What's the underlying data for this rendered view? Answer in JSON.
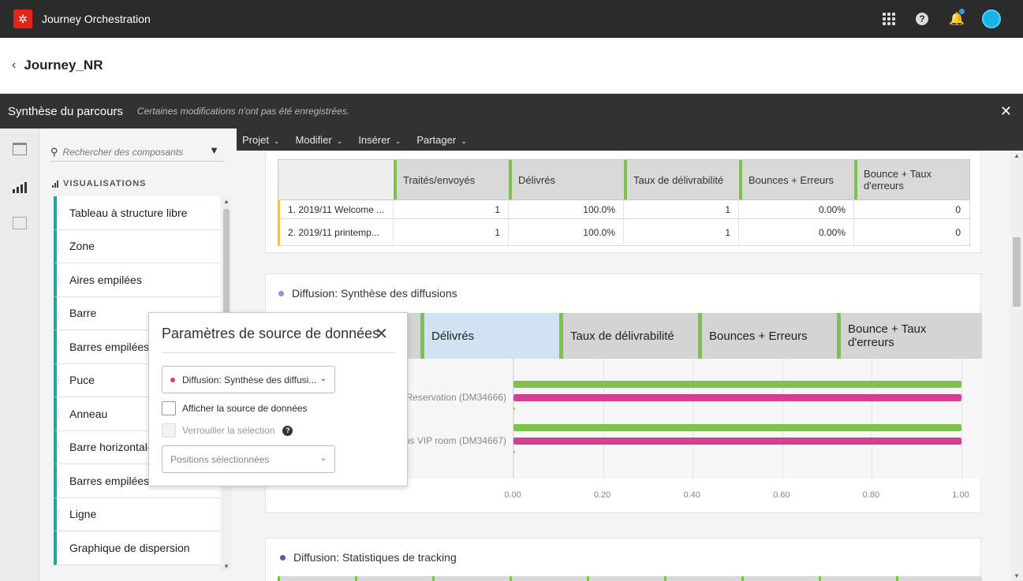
{
  "app": {
    "title": "Journey Orchestration"
  },
  "journey": {
    "name": "Journey_NR"
  },
  "summary_bar": {
    "title": "Synthèse du parcours",
    "note": "Certaines modifications n'ont pas été enregistrées."
  },
  "menu": [
    {
      "label": "Projet"
    },
    {
      "label": "Modifier"
    },
    {
      "label": "Insérer"
    },
    {
      "label": "Partager"
    }
  ],
  "components": {
    "search_placeholder": "Rechercher des composants",
    "section_title": "VISUALISATIONS",
    "items": [
      "Tableau à structure libre",
      "Zone",
      "Aires empilées",
      "Barre",
      "Barres empilées",
      "Puce",
      "Anneau",
      "Barre horizontale",
      "Barres empilées",
      "Ligne",
      "Graphique de dispersion"
    ]
  },
  "table1": {
    "columns": [
      "Traités/envoyés",
      "Délivrés",
      "Taux de délivrabilité",
      "Bounces + Erreurs",
      "Bounce + Taux d'erreurs"
    ],
    "rows": [
      {
        "name": "1.   2019/11 Welcome ...",
        "values": [
          "1",
          "100.0%",
          "1",
          "0.00%",
          "0"
        ]
      },
      {
        "name": "2.   2019/11 printemp...",
        "values": [
          "1",
          "100.0%",
          "1",
          "0.00%",
          "0"
        ]
      }
    ]
  },
  "card2": {
    "title": "Diffusion: Synthèse des diffusions",
    "dot_color": "#9b8ee0",
    "columns": [
      "Délivrés",
      "Taux de délivrabilité",
      "Bounces + Erreurs",
      "Bounce + Taux d'erreurs"
    ]
  },
  "chart_data": {
    "type": "bar",
    "categories": [
      "n Reservation (DM34666)",
      "mps VIP room (DM34667)"
    ],
    "series": [
      {
        "color": "#7ec24b",
        "values": [
          1.0,
          1.0
        ]
      },
      {
        "color": "#d43e93",
        "values": [
          1.0,
          1.0
        ]
      },
      {
        "color": "#f0a43a",
        "values": [
          0.0,
          0.0
        ]
      }
    ],
    "xlim": [
      0,
      1
    ],
    "x_ticks": [
      "0.00",
      "0.20",
      "0.40",
      "0.60",
      "0.80",
      "1.00"
    ],
    "grid": true
  },
  "card3": {
    "title": "Diffusion: Statistiques de tracking",
    "dot_color": "#4a5fa8"
  },
  "popover": {
    "title": "Paramètres de source de données",
    "source_value": "Diffusion: Synthèse des diffusi...",
    "show_source_label": "Afficher la source de données",
    "lock_label": "Verrouiller la sélection",
    "positions_placeholder": "Positions sélectionnées"
  }
}
